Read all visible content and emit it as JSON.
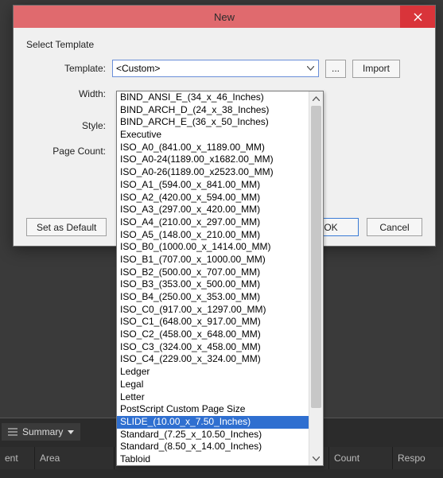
{
  "window": {
    "title": "New",
    "close_icon": "✕"
  },
  "form": {
    "group_label": "Select Template",
    "labels": {
      "template": "Template:",
      "width": "Width:",
      "style": "Style:",
      "page_count": "Page Count:"
    },
    "template_value": "<Custom>",
    "browse_label": "...",
    "import_label": "Import",
    "set_default_label": "Set as Default",
    "ok_label": "OK",
    "cancel_label": "Cancel"
  },
  "dropdown": {
    "selected_index": 26,
    "items": [
      "BIND_ANSI_E_(34_x_46_Inches)",
      "BIND_ARCH_D_(24_x_38_Inches)",
      "BIND_ARCH_E_(36_x_50_Inches)",
      "Executive",
      "ISO_A0_(841.00_x_1189.00_MM)",
      "ISO_A0-24(1189.00_x1682.00_MM)",
      "ISO_A0-26(1189.00_x2523.00_MM)",
      "ISO_A1_(594.00_x_841.00_MM)",
      "ISO_A2_(420.00_x_594.00_MM)",
      "ISO_A3_(297.00_x_420.00_MM)",
      "ISO_A4_(210.00_x_297.00_MM)",
      "ISO_A5_(148.00_x_210.00_MM)",
      "ISO_B0_(1000.00_x_1414.00_MM)",
      "ISO_B1_(707.00_x_1000.00_MM)",
      "ISO_B2_(500.00_x_707.00_MM)",
      "ISO_B3_(353.00_x_500.00_MM)",
      "ISO_B4_(250.00_x_353.00_MM)",
      "ISO_C0_(917.00_x_1297.00_MM)",
      "ISO_C1_(648.00_x_917.00_MM)",
      "ISO_C2_(458.00_x_648.00_MM)",
      "ISO_C3_(324.00_x_458.00_MM)",
      "ISO_C4_(229.00_x_324.00_MM)",
      "Ledger",
      "Legal",
      "Letter",
      "PostScript Custom Page Size",
      "SLIDE_(10.00_x_7.50_Inches)",
      "Standard_(7.25_x_10.50_Inches)",
      "Standard_(8.50_x_14.00_Inches)",
      "Tabloid"
    ]
  },
  "background": {
    "summary_label": "Summary",
    "columns": {
      "c0": "ent",
      "c1": "Area",
      "c2": "Count",
      "c3": "Respo"
    }
  }
}
